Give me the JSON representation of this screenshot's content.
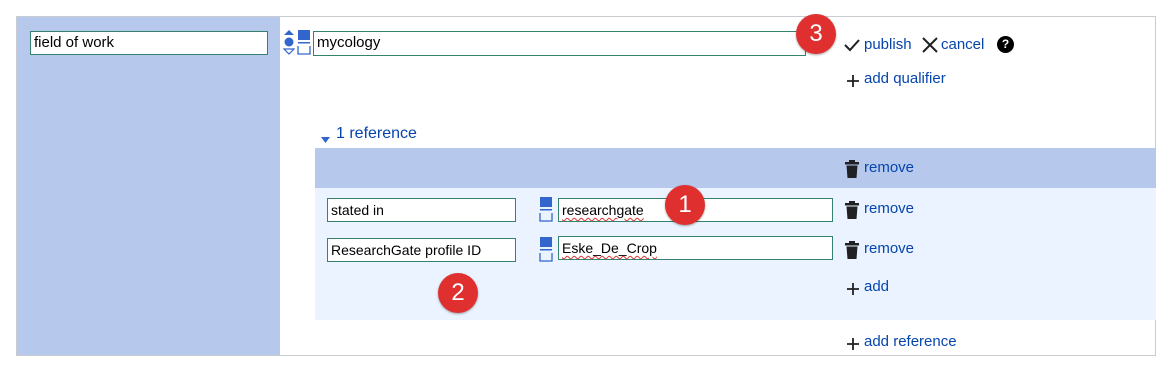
{
  "statement": {
    "property_value": "field of work",
    "value": "mycology",
    "publish_label": "publish",
    "cancel_label": "cancel",
    "help_label": "?",
    "add_qualifier_label": "add qualifier",
    "add_reference_label": "add reference"
  },
  "references": {
    "toggle_label": "1 reference",
    "remove_label": "remove",
    "snaks": [
      {
        "property": "stated in",
        "value": "researchgate",
        "remove_label": "remove"
      },
      {
        "property": "ResearchGate profile ID",
        "value": "Eske_De_Crop",
        "remove_label": "remove"
      }
    ],
    "add_label": "add"
  },
  "badges": [
    "1",
    "2",
    "3"
  ],
  "colors": {
    "property_bg": "#b6c8ec",
    "reference_body_bg": "#eaf3ff",
    "link": "#0645ad",
    "field_border": "#36826e",
    "badge": "#e02f2f"
  }
}
